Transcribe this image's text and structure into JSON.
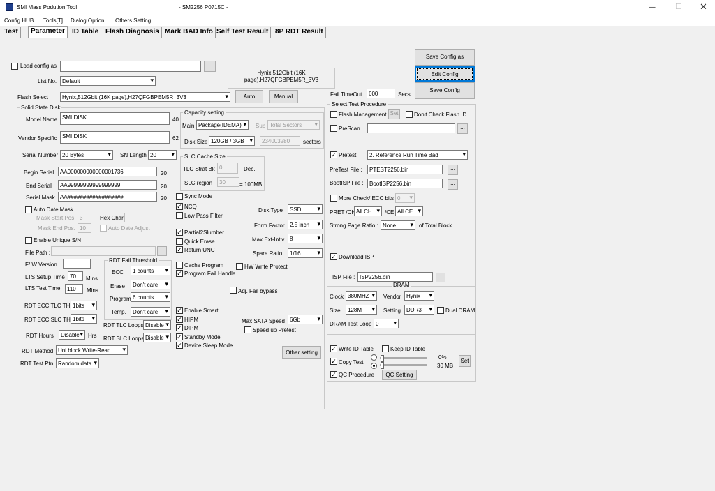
{
  "window": {
    "title": "SMI Mass Podution Tool",
    "subtitle": "- SM2256 P0715C -"
  },
  "menu": [
    "Config HUB",
    "Tools[T]",
    "Dialog Option",
    "Others Setting"
  ],
  "tabs": [
    "Test",
    "Parameter",
    "ID Table",
    "Flash Diagnosis",
    "Mark BAD Info",
    "Self Test Result",
    "8P RDT Result"
  ],
  "top": {
    "load_config_label": "Load config as",
    "load_config_value": "",
    "browse": "...",
    "list_no_label": "List No.",
    "list_no_value": "Default",
    "flash_info": "Hynix,512Gbit (16K page),H27QFGBPEM5R_3V3",
    "flash_select_label": "Flash Select",
    "flash_select_value": "Hynix,512Gbit (16K page),H27QFGBPEM5R_3V3",
    "auto_btn": "Auto",
    "manual_btn": "Manual",
    "save_config_as": "Save Config as",
    "edit_config": "Edit Config",
    "save_config": "Save Config",
    "fail_timeout_label": "Fail TimeOut",
    "fail_timeout_value": "600",
    "secs": "Secs"
  },
  "ssd": {
    "group_title": "Solid State Disk",
    "model_name_label": "Model Name",
    "model_name_value": "SMI DISK",
    "model_len": "40",
    "vendor_label": "Vendor Specific",
    "vendor_value": "SMI DISK",
    "vendor_len": "62",
    "serial_number_label": "Serial Number",
    "serial_number_value": "20 Bytes",
    "sn_length_label": "SN Length",
    "sn_length_value": "20",
    "begin_serial_label": "Begin Serial",
    "begin_serial_value": "AA000000000000001736",
    "begin_serial_len": "20",
    "end_serial_label": "End Serial",
    "end_serial_value": "AA99999999999999999",
    "end_serial_len": "20",
    "serial_mask_label": "Serial Mask",
    "serial_mask_value": "AA##################",
    "serial_mask_len": "20",
    "auto_date_mask": "Auto Date Mask",
    "mask_start_pos_label": "Mask Start Pos.",
    "mask_start_pos_value": "3",
    "hex_char_label": "Hex Char",
    "mask_end_pos_label": "Mask End Pos.",
    "mask_end_pos_value": "10",
    "auto_date_adjust": "Auto Date Adjust",
    "enable_unique_sn": "Enable Unique S/N",
    "file_path_label": "File Path :",
    "fw_version_label": "F/ W Version",
    "lts_setup_label": "LTS Setup Time",
    "lts_setup_value": "70",
    "lts_test_label": "LTS Test Time",
    "lts_test_value": "110",
    "mins": "Mins",
    "rdt_ecc_tlc_label": "RDT ECC TLC TH",
    "rdt_ecc_tlc_value": "1bits",
    "rdt_ecc_slc_label": "RDT ECC SLC TH",
    "rdt_ecc_slc_value": "1bits",
    "rdt_hours_label": "RDT Hours",
    "rdt_hours_value": "Disable",
    "hrs": "Hrs",
    "rdt_method_label": "RDT Method",
    "rdt_method_value": "Uni block Write-Read",
    "rdt_test_ptn_label": "RDT Test Ptn.",
    "rdt_test_ptn_value": "Random data"
  },
  "rdt_fail": {
    "title": "RDT Fail Threshold",
    "ecc_label": "ECC",
    "ecc_value": "1 counts",
    "erase_label": "Erase",
    "erase_value": "Don't care",
    "program_label": "Program",
    "program_value": "6 counts",
    "temp_label": "Temp.",
    "temp_value": "Don't care",
    "tlc_loops_label": "RDT TLC Loops",
    "tlc_loops_value": "Disable",
    "slc_loops_label": "RDT SLC Loops",
    "slc_loops_value": "Disable"
  },
  "capacity": {
    "title": "Capacity setting",
    "main_label": "Main",
    "main_value": "Package(IDEMA)",
    "sub_label": "Sub",
    "sub_value": "Total Sectors",
    "disk_size_label": "Disk Size",
    "disk_size_value": "120GB / 3GB",
    "sectors_value": "234003280",
    "sectors_label": "sectors"
  },
  "slc_cache": {
    "title": "SLC Cache Size",
    "tlc_strat_label": "TLC Strat Bk",
    "tlc_strat_value": "0",
    "dec": "Dec.",
    "slc_region_label": "SLC region",
    "slc_region_value": "30",
    "mb": "= 100MB"
  },
  "options": {
    "sync_mode": "Sync Mode",
    "ncq": "NCQ",
    "low_pass": "Low Pass Filter",
    "partial_slumber": "Partial2Slumber",
    "quick_erase": "Quick Erase",
    "return_unc": "Return UNC",
    "cache_program": "Cache Program",
    "hw_write_protect": "HW Write Protect",
    "program_fail_handle": "Program Fail Handle",
    "adj_fail_bypass": "Adj. Fail bypass",
    "enable_smart": "Enable Smart",
    "hipm": "HIPM",
    "dipm": "DIPM",
    "standby_mode": "Standby Mode",
    "device_sleep_mode": "Device Sleep Mode",
    "disk_type_label": "Disk Type",
    "disk_type_value": "SSD",
    "form_factor_label": "Form Factor",
    "form_factor_value": "2.5 inch",
    "max_ext_label": "Max Ext-Intlv",
    "max_ext_value": "8",
    "spare_ratio_label": "Spare Ratio",
    "spare_ratio_value": "1/16",
    "max_sata_label": "Max SATA Speed",
    "max_sata_value": "6Gb",
    "speed_up_pretest": "Speed up Pretest",
    "other_setting": "Other setting"
  },
  "procedure": {
    "title": "Select Test Procedure",
    "flash_management": "Flash Management",
    "set": "Set",
    "dont_check_flash_id": "Don't Check Flash ID",
    "prescan": "PreScan",
    "pretest": "Pretest",
    "pretest_value": "2. Reference Run Time Bad",
    "pretest_file_label": "PreTest File :",
    "pretest_file_value": "PTEST2256.bin",
    "bootisp_file_label": "BootISP File :",
    "bootisp_file_value": "BootISP2256.bin",
    "more_check": "More Check",
    "ecc_bits_label": "/ ECC bits",
    "ecc_bits_value": "0",
    "pret_ch_label": "PRET /CH",
    "pret_ch_value": "All CH",
    "ce_label": "/CE",
    "ce_value": "All CE",
    "strong_page_label": "Strong Page Ratio :",
    "strong_page_value": "None",
    "of_total_block": "of Total Block",
    "download_isp": "Download ISP",
    "isp_file_label": "ISP File :",
    "isp_file_value": "ISP2256.bin"
  },
  "dram": {
    "title": "DRAM",
    "clock_label": "Clock",
    "clock_value": "380MHZ",
    "vendor_label": "Vendor",
    "vendor_value": "Hynix",
    "size_label": "Size",
    "size_value": "128M",
    "setting_label": "Setting",
    "setting_value": "DDR3",
    "dual_dram": "Dual DRAM",
    "test_loop_label": "DRAM Test Loop",
    "test_loop_value": "0"
  },
  "bottom_right": {
    "write_id_table": "Write ID Table",
    "keep_id_table": "Keep ID Table",
    "copy_test": "Copy Test",
    "percent": "0%",
    "size": "30 MB",
    "set": "Set",
    "qc_procedure": "QC Procedure",
    "qc_setting": "QC Setting"
  },
  "check_mark": "✓"
}
